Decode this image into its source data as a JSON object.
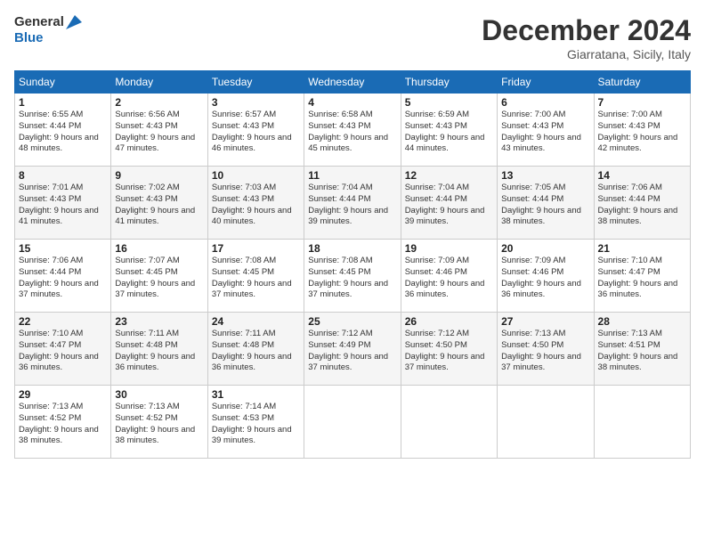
{
  "header": {
    "logo_line1": "General",
    "logo_line2": "Blue",
    "month_title": "December 2024",
    "location": "Giarratana, Sicily, Italy"
  },
  "weekdays": [
    "Sunday",
    "Monday",
    "Tuesday",
    "Wednesday",
    "Thursday",
    "Friday",
    "Saturday"
  ],
  "weeks": [
    [
      {
        "day": "1",
        "rise": "Sunrise: 6:55 AM",
        "set": "Sunset: 4:44 PM",
        "daylight": "Daylight: 9 hours and 48 minutes."
      },
      {
        "day": "2",
        "rise": "Sunrise: 6:56 AM",
        "set": "Sunset: 4:43 PM",
        "daylight": "Daylight: 9 hours and 47 minutes."
      },
      {
        "day": "3",
        "rise": "Sunrise: 6:57 AM",
        "set": "Sunset: 4:43 PM",
        "daylight": "Daylight: 9 hours and 46 minutes."
      },
      {
        "day": "4",
        "rise": "Sunrise: 6:58 AM",
        "set": "Sunset: 4:43 PM",
        "daylight": "Daylight: 9 hours and 45 minutes."
      },
      {
        "day": "5",
        "rise": "Sunrise: 6:59 AM",
        "set": "Sunset: 4:43 PM",
        "daylight": "Daylight: 9 hours and 44 minutes."
      },
      {
        "day": "6",
        "rise": "Sunrise: 7:00 AM",
        "set": "Sunset: 4:43 PM",
        "daylight": "Daylight: 9 hours and 43 minutes."
      },
      {
        "day": "7",
        "rise": "Sunrise: 7:00 AM",
        "set": "Sunset: 4:43 PM",
        "daylight": "Daylight: 9 hours and 42 minutes."
      }
    ],
    [
      {
        "day": "8",
        "rise": "Sunrise: 7:01 AM",
        "set": "Sunset: 4:43 PM",
        "daylight": "Daylight: 9 hours and 41 minutes."
      },
      {
        "day": "9",
        "rise": "Sunrise: 7:02 AM",
        "set": "Sunset: 4:43 PM",
        "daylight": "Daylight: 9 hours and 41 minutes."
      },
      {
        "day": "10",
        "rise": "Sunrise: 7:03 AM",
        "set": "Sunset: 4:43 PM",
        "daylight": "Daylight: 9 hours and 40 minutes."
      },
      {
        "day": "11",
        "rise": "Sunrise: 7:04 AM",
        "set": "Sunset: 4:44 PM",
        "daylight": "Daylight: 9 hours and 39 minutes."
      },
      {
        "day": "12",
        "rise": "Sunrise: 7:04 AM",
        "set": "Sunset: 4:44 PM",
        "daylight": "Daylight: 9 hours and 39 minutes."
      },
      {
        "day": "13",
        "rise": "Sunrise: 7:05 AM",
        "set": "Sunset: 4:44 PM",
        "daylight": "Daylight: 9 hours and 38 minutes."
      },
      {
        "day": "14",
        "rise": "Sunrise: 7:06 AM",
        "set": "Sunset: 4:44 PM",
        "daylight": "Daylight: 9 hours and 38 minutes."
      }
    ],
    [
      {
        "day": "15",
        "rise": "Sunrise: 7:06 AM",
        "set": "Sunset: 4:44 PM",
        "daylight": "Daylight: 9 hours and 37 minutes."
      },
      {
        "day": "16",
        "rise": "Sunrise: 7:07 AM",
        "set": "Sunset: 4:45 PM",
        "daylight": "Daylight: 9 hours and 37 minutes."
      },
      {
        "day": "17",
        "rise": "Sunrise: 7:08 AM",
        "set": "Sunset: 4:45 PM",
        "daylight": "Daylight: 9 hours and 37 minutes."
      },
      {
        "day": "18",
        "rise": "Sunrise: 7:08 AM",
        "set": "Sunset: 4:45 PM",
        "daylight": "Daylight: 9 hours and 37 minutes."
      },
      {
        "day": "19",
        "rise": "Sunrise: 7:09 AM",
        "set": "Sunset: 4:46 PM",
        "daylight": "Daylight: 9 hours and 36 minutes."
      },
      {
        "day": "20",
        "rise": "Sunrise: 7:09 AM",
        "set": "Sunset: 4:46 PM",
        "daylight": "Daylight: 9 hours and 36 minutes."
      },
      {
        "day": "21",
        "rise": "Sunrise: 7:10 AM",
        "set": "Sunset: 4:47 PM",
        "daylight": "Daylight: 9 hours and 36 minutes."
      }
    ],
    [
      {
        "day": "22",
        "rise": "Sunrise: 7:10 AM",
        "set": "Sunset: 4:47 PM",
        "daylight": "Daylight: 9 hours and 36 minutes."
      },
      {
        "day": "23",
        "rise": "Sunrise: 7:11 AM",
        "set": "Sunset: 4:48 PM",
        "daylight": "Daylight: 9 hours and 36 minutes."
      },
      {
        "day": "24",
        "rise": "Sunrise: 7:11 AM",
        "set": "Sunset: 4:48 PM",
        "daylight": "Daylight: 9 hours and 36 minutes."
      },
      {
        "day": "25",
        "rise": "Sunrise: 7:12 AM",
        "set": "Sunset: 4:49 PM",
        "daylight": "Daylight: 9 hours and 37 minutes."
      },
      {
        "day": "26",
        "rise": "Sunrise: 7:12 AM",
        "set": "Sunset: 4:50 PM",
        "daylight": "Daylight: 9 hours and 37 minutes."
      },
      {
        "day": "27",
        "rise": "Sunrise: 7:13 AM",
        "set": "Sunset: 4:50 PM",
        "daylight": "Daylight: 9 hours and 37 minutes."
      },
      {
        "day": "28",
        "rise": "Sunrise: 7:13 AM",
        "set": "Sunset: 4:51 PM",
        "daylight": "Daylight: 9 hours and 38 minutes."
      }
    ],
    [
      {
        "day": "29",
        "rise": "Sunrise: 7:13 AM",
        "set": "Sunset: 4:52 PM",
        "daylight": "Daylight: 9 hours and 38 minutes."
      },
      {
        "day": "30",
        "rise": "Sunrise: 7:13 AM",
        "set": "Sunset: 4:52 PM",
        "daylight": "Daylight: 9 hours and 38 minutes."
      },
      {
        "day": "31",
        "rise": "Sunrise: 7:14 AM",
        "set": "Sunset: 4:53 PM",
        "daylight": "Daylight: 9 hours and 39 minutes."
      },
      null,
      null,
      null,
      null
    ]
  ]
}
